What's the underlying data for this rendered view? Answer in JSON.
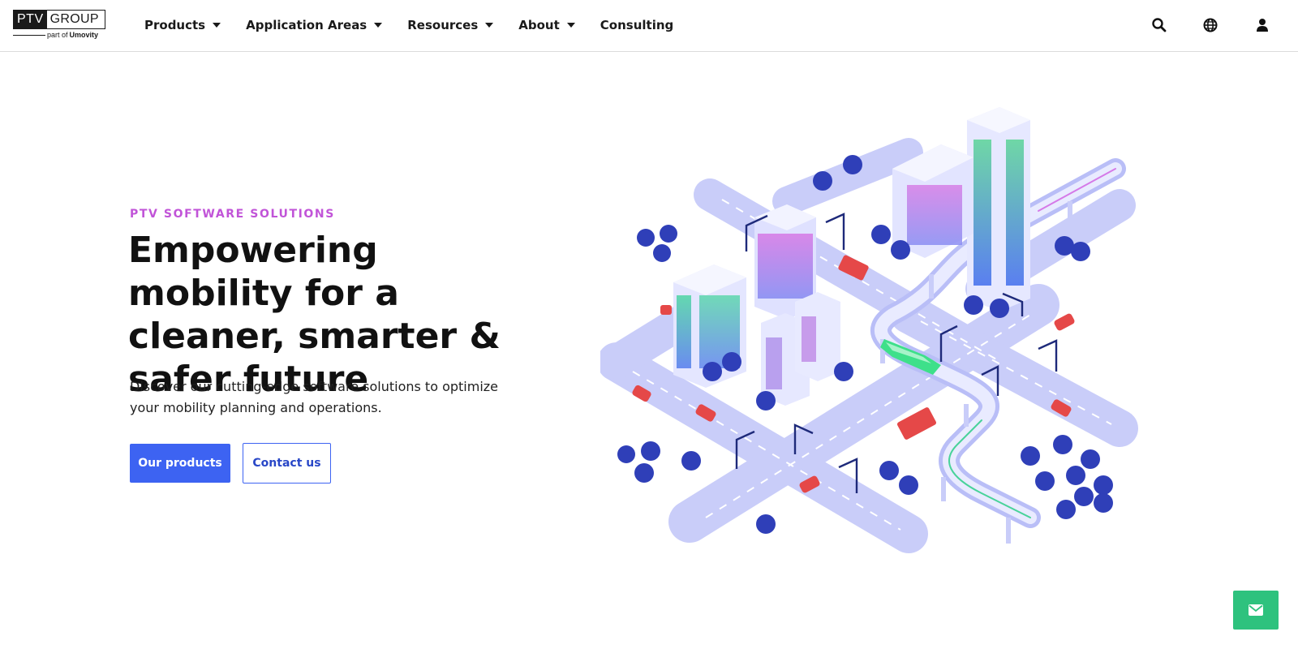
{
  "brand": {
    "logo_primary": "PTV",
    "logo_secondary": "GROUP",
    "logo_tagline_prefix": "part of",
    "logo_tagline_brand": "Umovity"
  },
  "nav": {
    "items": [
      {
        "label": "Products",
        "has_dropdown": true
      },
      {
        "label": "Application Areas",
        "has_dropdown": true
      },
      {
        "label": "Resources",
        "has_dropdown": true
      },
      {
        "label": "About",
        "has_dropdown": true
      },
      {
        "label": "Consulting",
        "has_dropdown": false
      }
    ],
    "icons": [
      "search-icon",
      "globe-icon",
      "user-icon"
    ]
  },
  "hero": {
    "eyebrow": "PTV SOFTWARE SOLUTIONS",
    "headline": "Empowering mobility for a cleaner, smarter & safer future",
    "subtext": "Discover our cutting-edge software solutions to optimize your mobility planning and operations.",
    "primary_button": "Our products",
    "secondary_button": "Contact us"
  },
  "floating_action": {
    "icon": "envelope-icon"
  },
  "colors": {
    "accent_blue": "#3d63f2",
    "eyebrow_purple": "#c154d8",
    "fab_green": "#2ec27e",
    "road_lavender": "#c9cdf9",
    "tree_blue": "#2f3fb8",
    "car_red": "#e54848",
    "tram_green": "#3ee08a"
  }
}
